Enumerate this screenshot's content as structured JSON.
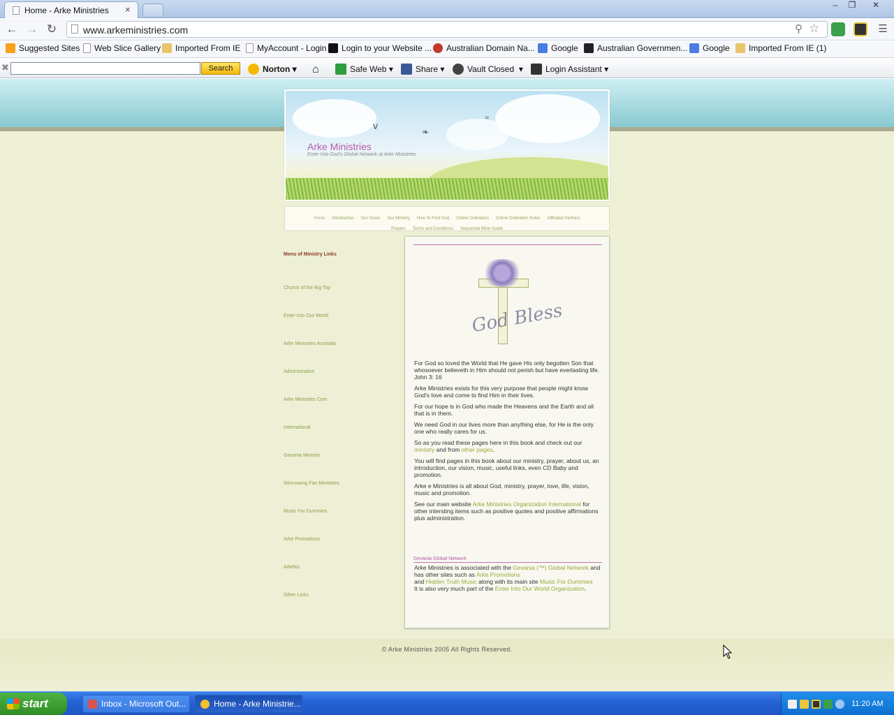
{
  "browser": {
    "tab_title": "Home - Arke Ministries",
    "tab_close": "×",
    "url": "www.arkeministries.com",
    "window_controls": {
      "minimize": "–",
      "restore": "❐",
      "close": "✕"
    }
  },
  "bookmarks": [
    {
      "label": "Suggested Sites",
      "icon": "suggested-icon",
      "color": "#f7a21b"
    },
    {
      "label": "Web Slice Gallery",
      "icon": "page-icon",
      "color": "#ffffff"
    },
    {
      "label": "Imported From IE",
      "icon": "folder-icon",
      "color": "#e9c46a"
    },
    {
      "label": "MyAccount - Login",
      "icon": "page-icon",
      "color": "#ffffff"
    },
    {
      "label": "Login to your Website ...",
      "icon": "w-icon",
      "color": "#111111"
    },
    {
      "label": "Australian Domain Na...",
      "icon": "domain-icon",
      "color": "#c0392b"
    },
    {
      "label": "Google",
      "icon": "google-icon",
      "color": "#4a7de2"
    },
    {
      "label": "Australian Governmen...",
      "icon": "gov-icon",
      "color": "#222222"
    },
    {
      "label": "Google",
      "icon": "google-icon",
      "color": "#4a7de2"
    },
    {
      "label": "Imported From IE (1)",
      "icon": "folder-icon",
      "color": "#e9c46a"
    }
  ],
  "norton": {
    "search_placeholder": "",
    "search_button": "Search",
    "brand": "Norton",
    "items": [
      {
        "label": "Safe Web",
        "icon": "safe-web-icon",
        "color": "#2e9e3e"
      },
      {
        "label": "Share",
        "icon": "facebook-icon",
        "color": "#3b5998"
      },
      {
        "label": "Vault Closed",
        "icon": "vault-icon",
        "color": "#444444"
      },
      {
        "label": "Login Assistant",
        "icon": "login-assistant-icon",
        "color": "#333333"
      }
    ],
    "dropdown_arrow": "▾"
  },
  "site": {
    "title": "Arke Ministries",
    "subtitle": "Enter Into God's Global Network at Arke Ministries",
    "menu": [
      "Home",
      "Introduction",
      "Our Vision",
      "Our Ministry",
      "How To Find God",
      "Online Ordination",
      "Online Ordination Rules",
      "Affiliated Partners",
      "Prayers",
      "Terms and Conditions",
      "Sequential Bible Guide"
    ],
    "sidebar_heading": "Menu of Ministry Links",
    "sidebar_links": [
      "Church of the Big Top",
      "Enter Into Our World",
      "Arke Ministries Australia",
      "Administration",
      "Arke Ministries Com",
      "International",
      "Gevania Ministry",
      "Winnowing Fan Ministries",
      "Music For Dummies",
      "Arke Promotions",
      "Arkebiz",
      "Other Links"
    ],
    "image_caption": "God Bless",
    "paragraphs": {
      "p1": "For God so loved the World that He gave His only begotten Son that whosoever believeth in Him should not perish but have everlasting life. John  3: 16",
      "p2": "Arke Ministries exists for this very purpose that people might know God's love and come to find Him in their lives.",
      "p3": "For our hope is in God who made the Heavens and the Earth and all that is in them.",
      "p4": "We need God in our lives more than anything else, for He is the only one who really cares for us.",
      "p5_a": "So as you read these pages here in this book and check out our ",
      "p5_link1": "ministry",
      "p5_b": " and from ",
      "p5_link2": "other pages",
      "p5_c": ".",
      "p6": "You will find pages in this book about our ministry, prayer, about us, an introduction, our vision, music, useful links, even CD Baby and promotion.",
      "p7": "Arke e Ministries is all about God, ministry, prayer, love, life, vision, music and promotion.",
      "p8_a": "See our main website ",
      "p8_link": "Arke Ministries Organization International",
      "p8_b": " for other intersting items such as positive quotes and positive affirmations plus administration."
    },
    "network": {
      "label": "Gevania Global Network",
      "a": "Arke Ministries is associated with the ",
      "link1": "Gevania (™) Global Network",
      "b": " and has other sites such as ",
      "link2": "Arke Promotions",
      "c": "and ",
      "link3": "Hidden Truth Music",
      "d": " along with its main site ",
      "link4": "Music For Dummies",
      "e": "It is also very much part of the ",
      "link5": "Enter Into Our World Organization",
      "f": "."
    },
    "footer": "©  Arke Ministries 2005 All Rights Reserved."
  },
  "taskbar": {
    "start": "start",
    "tasks": [
      {
        "label": "Inbox - Microsoft Out...",
        "icon": "outlook-icon",
        "color": "#d9534f"
      },
      {
        "label": "Home - Arke Ministrie...",
        "icon": "chrome-icon",
        "color": "#f2c12e"
      }
    ],
    "clock": "11:20 AM"
  }
}
